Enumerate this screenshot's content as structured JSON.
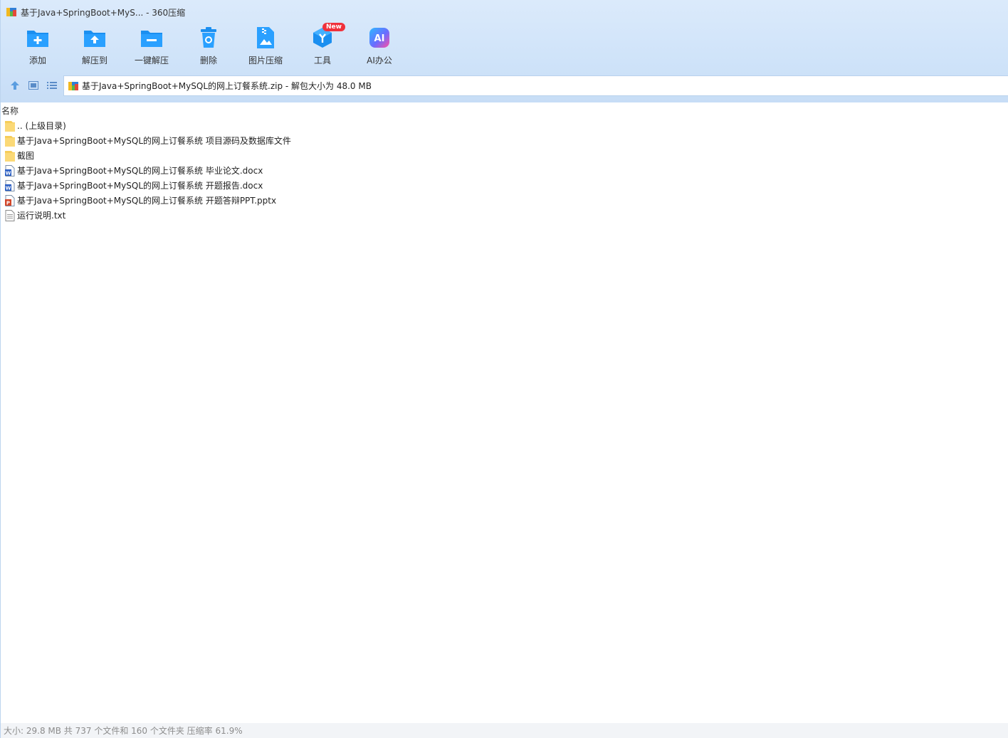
{
  "window": {
    "title": "基于Java+SpringBoot+MyS... - 360压缩"
  },
  "toolbar": {
    "items": [
      {
        "label": "添加",
        "icon": "add-folder-icon"
      },
      {
        "label": "解压到",
        "icon": "extract-to-icon"
      },
      {
        "label": "一键解压",
        "icon": "one-click-extract-icon"
      },
      {
        "label": "删除",
        "icon": "recycle-bin-icon"
      },
      {
        "label": "图片压缩",
        "icon": "image-compress-icon"
      },
      {
        "label": "工具",
        "icon": "tools-cube-icon",
        "badge": "New"
      },
      {
        "label": "AI办公",
        "icon": "ai-office-icon"
      }
    ],
    "badge_color": "#f0313b",
    "accent": "#1e90ff"
  },
  "navbar": {
    "buttons": [
      "up-arrow-icon",
      "thumbnail-view-icon",
      "list-view-icon"
    ],
    "address": "基于Java+SpringBoot+MySQL的网上订餐系统.zip - 解包大小为 48.0 MB"
  },
  "filelist": {
    "column_name": "名称",
    "rows": [
      {
        "name": ".. (上级目录)",
        "type": "folder"
      },
      {
        "name": "基于Java+SpringBoot+MySQL的网上订餐系统 项目源码及数据库文件",
        "type": "folder"
      },
      {
        "name": "截图",
        "type": "folder"
      },
      {
        "name": "基于Java+SpringBoot+MySQL的网上订餐系统 毕业论文.docx",
        "type": "word"
      },
      {
        "name": "基于Java+SpringBoot+MySQL的网上订餐系统 开题报告.docx",
        "type": "word"
      },
      {
        "name": "基于Java+SpringBoot+MySQL的网上订餐系统 开题答辩PPT.pptx",
        "type": "ppt"
      },
      {
        "name": "运行说明.txt",
        "type": "txt"
      }
    ]
  },
  "status": {
    "text": "大小: 29.8 MB 共 737 个文件和 160 个文件夹 压缩率 61.9%"
  }
}
